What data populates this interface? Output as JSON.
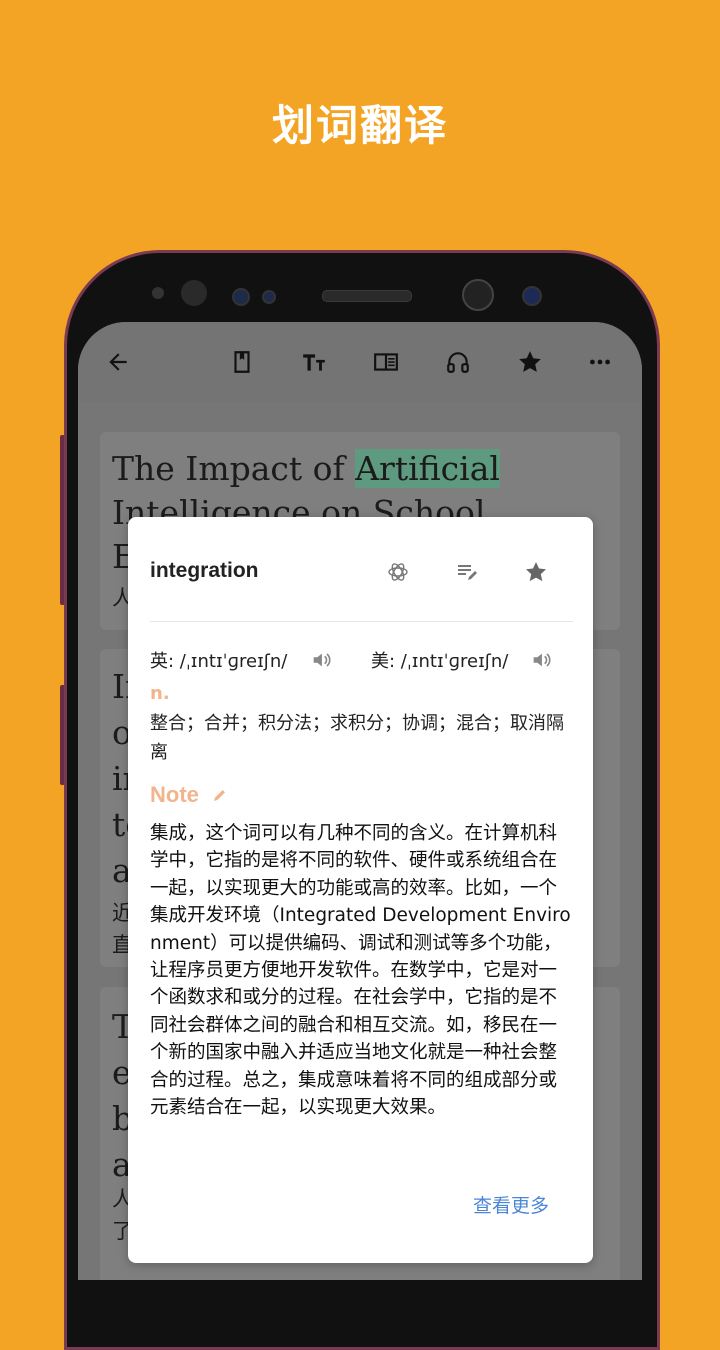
{
  "page": {
    "title": "划词翻译"
  },
  "toolbar": {
    "icons": [
      "back-arrow-icon",
      "bookmark-icon",
      "text-size-icon",
      "reader-layout-icon",
      "headphones-icon",
      "star-icon",
      "more-icon"
    ]
  },
  "article": {
    "card1": {
      "title_pre": "The Impact of ",
      "title_highlight": "Artificial",
      "line2": "Intelligence on School",
      "line3": "E",
      "sub": "人"
    },
    "card2": {
      "lines": [
        "In",
        "o",
        "in",
        "to",
        "a"
      ],
      "sub": [
        "近",
        "直"
      ]
    },
    "card3": {
      "lines": [
        "T",
        "e",
        "b",
        "a"
      ],
      "sub": [
        "人",
        "了"
      ]
    }
  },
  "popup": {
    "word": "integration",
    "uk_label": "英: /ˌɪntɪˈɡreɪʃn/",
    "us_label": "美: /ˌɪntɪˈɡreɪʃn/",
    "pos": "n.",
    "definition": "整合；合并；积分法；求积分；协调；混合；取消隔离",
    "note_label": "Note",
    "note": "集成，这个词可以有几种不同的含义。在计算机科学中，它指的是将不同的软件、硬件或系统组合在一起，以实现更大的功能或高的效率。比如，一个集成开发环境（Integrated Development Environment）可以提供编码、调试和测试等多个功能，让程序员更方便地开发软件。在数学中，它是对一个函数求和或分的过程。在社会学中，它指的是不同社会群体之间的融合和相互交流。如，移民在一个新的国家中融入并适应当地文化就是一种社会整合的过程。总之，集成意味着将不同的组成部分或元素结合在一起，以实现更大效果。",
    "more_label": "查看更多"
  }
}
